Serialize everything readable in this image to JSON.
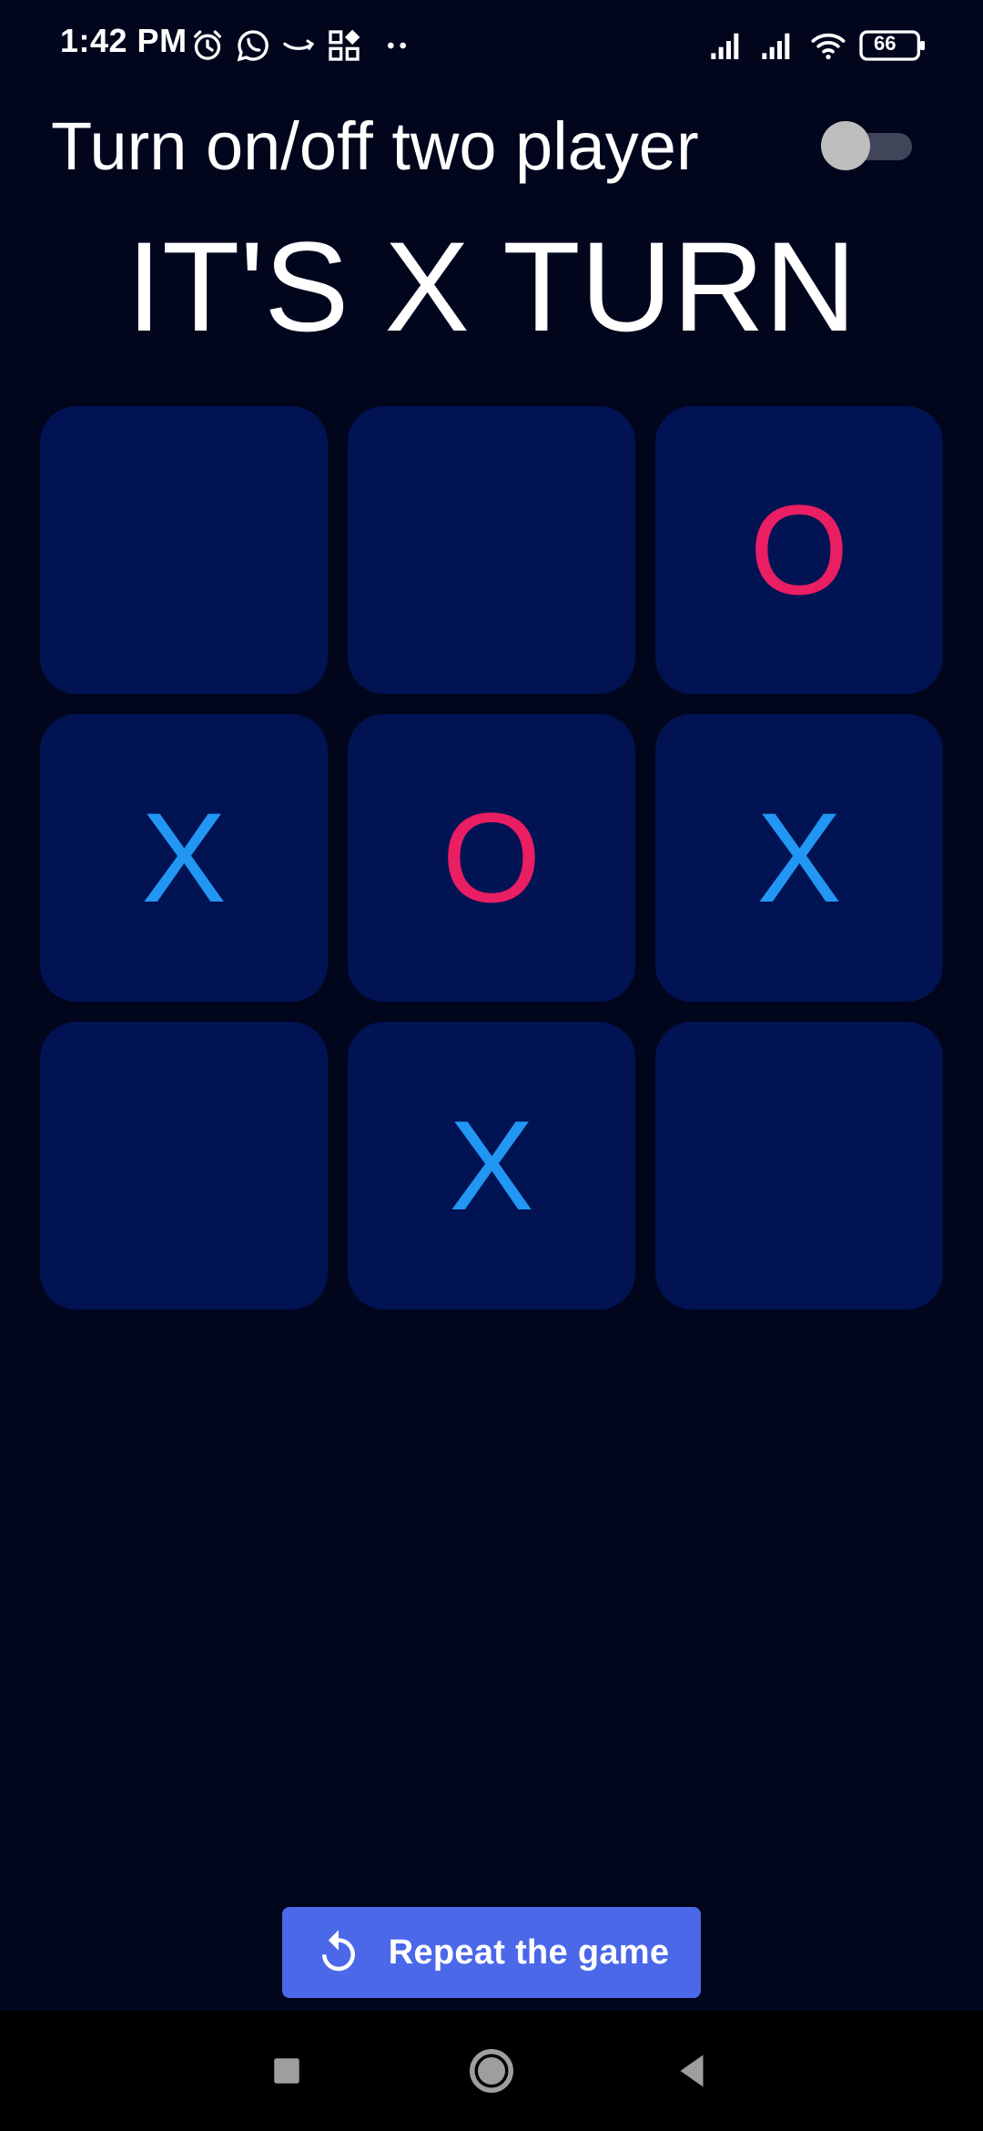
{
  "status_bar": {
    "time": "1:42 PM",
    "battery_level": "66",
    "icons": [
      "alarm-icon",
      "whatsapp-icon",
      "amazon-icon",
      "app-grid-icon",
      "more-dots-icon",
      "signal-icon",
      "signal-icon",
      "wifi-icon",
      "battery-icon"
    ]
  },
  "header": {
    "toggle_label": "Turn on/off two player",
    "two_player_enabled": false
  },
  "game": {
    "turn_text": "IT'S X TURN",
    "board": [
      [
        "",
        "",
        "O"
      ],
      [
        "X",
        "O",
        "X"
      ],
      [
        "",
        "X",
        ""
      ]
    ],
    "cells": {
      "c0": "",
      "c1": "",
      "c2": "O",
      "c3": "X",
      "c4": "O",
      "c5": "X",
      "c6": "",
      "c7": "X",
      "c8": ""
    }
  },
  "actions": {
    "repeat_label": "Repeat the game",
    "repeat_icon": "replay-icon"
  },
  "navigation": {
    "buttons": [
      "recent-apps-icon",
      "home-icon",
      "back-icon"
    ]
  },
  "colors": {
    "background": "#01061d",
    "cell": "#011353",
    "x_mark": "#2196f3",
    "o_mark": "#e91e63",
    "button": "#4a68e8"
  }
}
